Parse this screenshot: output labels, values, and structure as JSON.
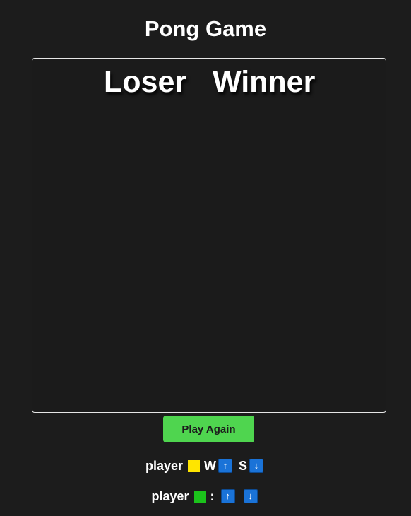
{
  "title": "Pong Game",
  "board": {
    "left_result": "Loser",
    "right_result": "Winner"
  },
  "button": {
    "play_again": "Play Again"
  },
  "controls": {
    "player1": {
      "label": "player",
      "color": "#ffe500",
      "up_key": "W",
      "up_icon": "↑",
      "down_key": "S",
      "down_icon": "↓"
    },
    "player2": {
      "label": "player",
      "color": "#1bc21b",
      "separator": ":",
      "up_icon": "↑",
      "down_icon": "↓"
    }
  },
  "colors": {
    "background": "#1c1c1c",
    "button": "#4fd54f",
    "key": "#1a73d8"
  },
  "icons": {
    "up": "arrow-up-icon",
    "down": "arrow-down-icon"
  }
}
